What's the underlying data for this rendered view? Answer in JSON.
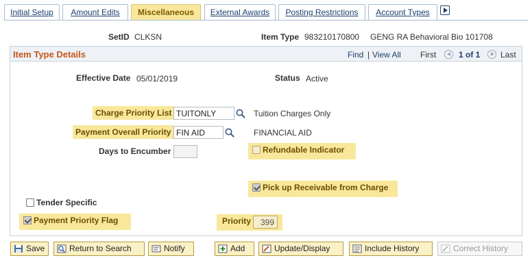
{
  "tabs": [
    {
      "label": "Initial Setup",
      "active": false
    },
    {
      "label": "Amount Edits",
      "active": false
    },
    {
      "label": "Miscellaneous",
      "active": true
    },
    {
      "label": "External Awards",
      "active": false
    },
    {
      "label": "Posting Restrictions",
      "active": false
    },
    {
      "label": "Account Types",
      "active": false
    }
  ],
  "header": {
    "setid_label": "SetID",
    "setid_value": "CLKSN",
    "item_type_label": "Item Type",
    "item_type_value": "983210170800",
    "item_type_desc": "GENG RA Behavioral Bio 101708"
  },
  "group": {
    "title": "Item Type Details",
    "find": "Find",
    "separator": "|",
    "view_all": "View All",
    "first": "First",
    "count": "1 of 1",
    "last": "Last"
  },
  "details": {
    "effective_date_label": "Effective Date",
    "effective_date_value": "05/01/2019",
    "status_label": "Status",
    "status_value": "Active",
    "charge_priority_label": "Charge Priority List",
    "charge_priority_value": "TUITONLY",
    "charge_priority_desc": "Tuition Charges Only",
    "payment_overall_label": "Payment Overall Priority",
    "payment_overall_value": "FIN AID",
    "payment_overall_desc": "FINANCIAL AID",
    "days_encumber_label": "Days to Encumber",
    "days_encumber_value": "",
    "refundable_label": "Refundable Indicator",
    "refundable_checked": false,
    "pickup_label": "Pick up Receivable from Charge",
    "pickup_checked": true,
    "tender_label": "Tender Specific",
    "tender_checked": false,
    "payment_flag_label": "Payment Priority Flag",
    "payment_flag_checked": true,
    "priority_label": "Priority",
    "priority_value": "399"
  },
  "toolbar": {
    "save": "Save",
    "return": "Return to Search",
    "notify": "Notify",
    "add": "Add",
    "update": "Update/Display",
    "include_history": "Include History",
    "correct_history": "Correct History"
  },
  "colors": {
    "highlight": "#f9e89b",
    "group_title": "#c6571a",
    "link": "#1c3f6e"
  }
}
